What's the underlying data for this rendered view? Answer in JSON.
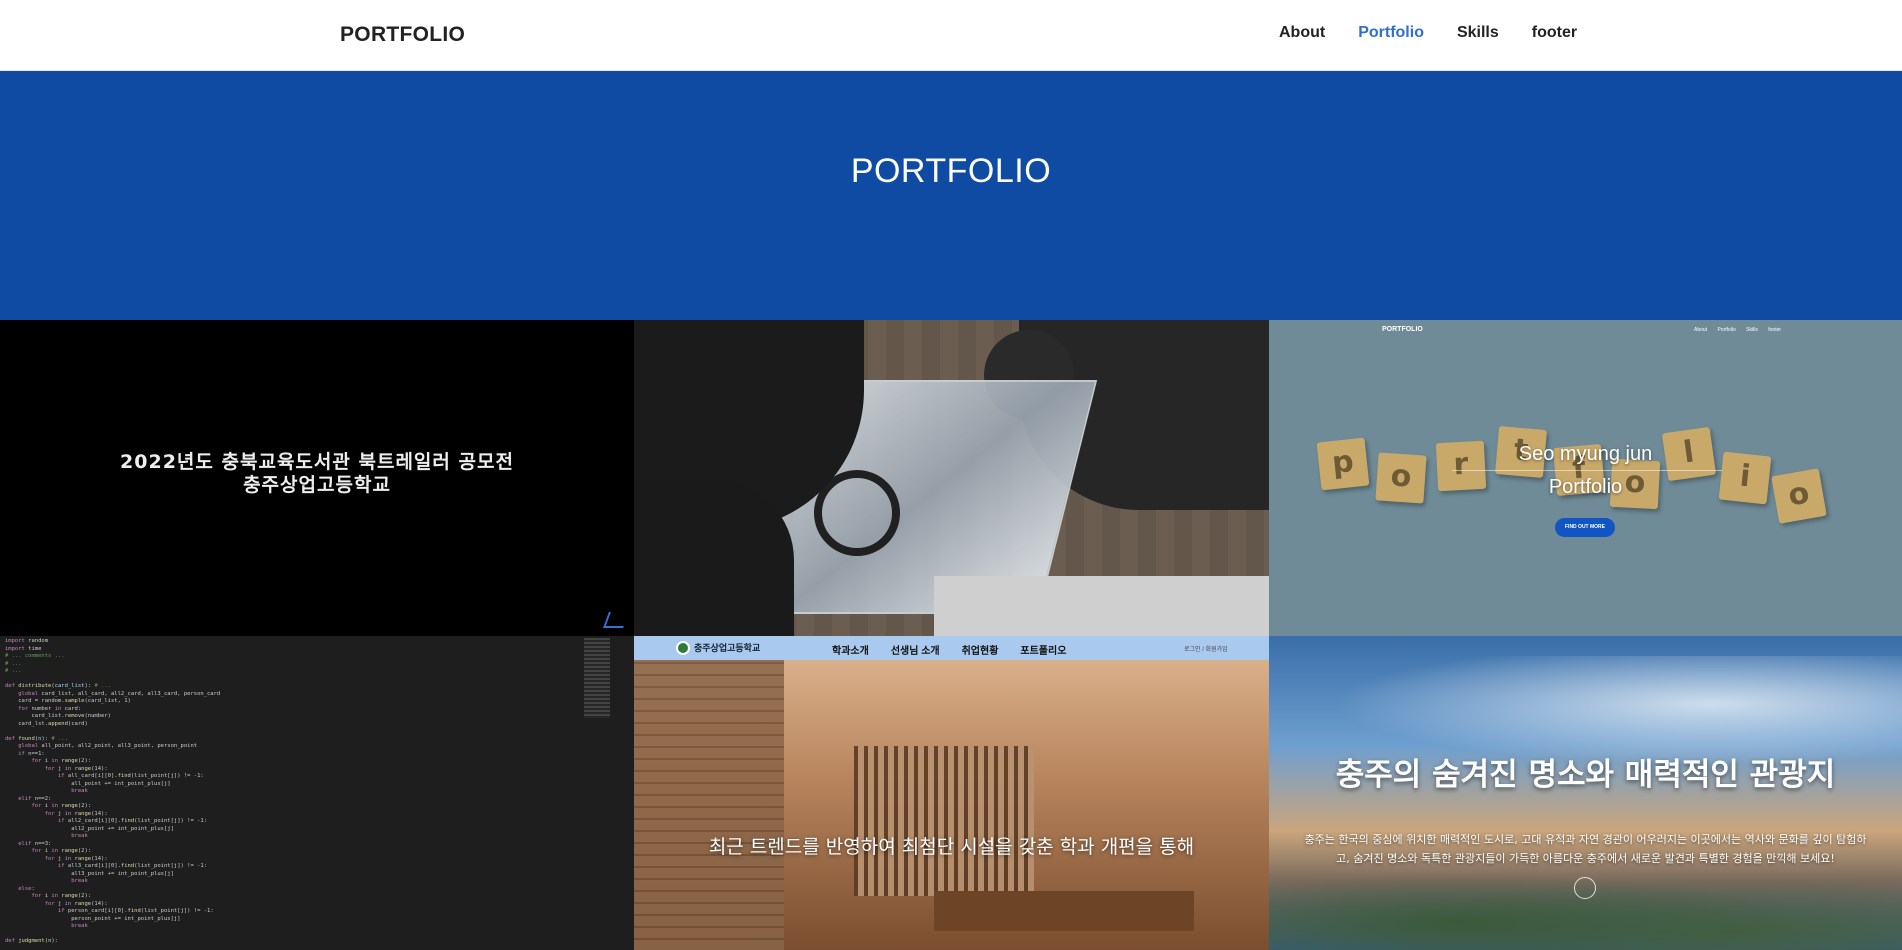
{
  "navbar": {
    "brand": "PORTFOLIO",
    "links": [
      "About",
      "Portfolio",
      "Skills",
      "footer"
    ],
    "active": "Portfolio",
    "accent": "#2f6fd0"
  },
  "hero": {
    "title": "PORTFOLIO",
    "background": "#0f4aa3"
  },
  "projects": {
    "p1": {
      "text": "2022년도 충북교육도서관 북트레일러 공모전\n충주상업고등학교"
    },
    "p3": {
      "mini_brand": "PORTFOLIO",
      "mini_links": "About Portfolio Skills footer",
      "letters": [
        "p",
        "o",
        "r",
        "t",
        "f",
        "o",
        "l",
        "i",
        "o"
      ],
      "title_line1": "Seo myung jun",
      "title_line2": "Portfolio",
      "button": "FIND OUT MORE"
    },
    "p4": {
      "language": "python"
    },
    "p5": {
      "logo_text": "충주상업고등학교",
      "menu": [
        "학과소개",
        "선생님 소개",
        "취업현황",
        "포트폴리오"
      ],
      "login": "로그인 / 회원가입",
      "caption": "최근 트렌드를 반영하여 최첨단 시설을 갖춘 학과 개편을 통해"
    },
    "p6": {
      "heading": "충주의 숨겨진 명소와 매력적인 관광지",
      "body": "충주는 한국의 중심에 위치한 매력적인 도시로, 고대 유적과 자연 경관이 어우러지는 이곳에서는 역사와 문화를 깊이 탐험하고, 숨겨진 명소와 독특한 관광지들이 가득한 아름다운 충주에서 새로운 발견과 특별한 경험을 만끽해 보세요!"
    }
  }
}
